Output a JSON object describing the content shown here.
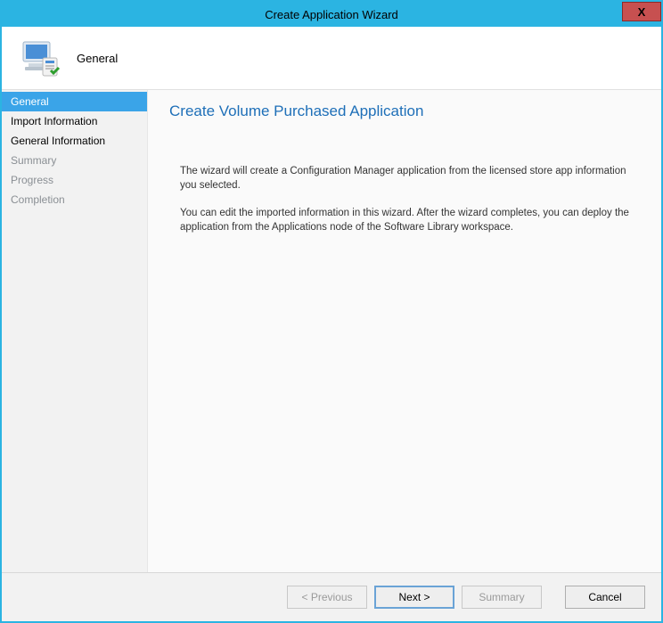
{
  "window": {
    "title": "Create Application Wizard",
    "close_label": "X"
  },
  "header": {
    "step_label": "General"
  },
  "sidebar": {
    "items": [
      {
        "label": "General",
        "state": "active"
      },
      {
        "label": "Import Information",
        "state": "normal"
      },
      {
        "label": "General Information",
        "state": "normal"
      },
      {
        "label": "Summary",
        "state": "dim"
      },
      {
        "label": "Progress",
        "state": "dim"
      },
      {
        "label": "Completion",
        "state": "dim"
      }
    ]
  },
  "content": {
    "heading": "Create Volume Purchased Application",
    "paragraph1": "The wizard will create a Configuration Manager application from the licensed store app information you selected.",
    "paragraph2": "You can edit the imported information in this wizard. After the wizard completes, you can deploy the application from the Applications node of the Software Library workspace."
  },
  "footer": {
    "previous": "< Previous",
    "next": "Next >",
    "summary": "Summary",
    "cancel": "Cancel"
  }
}
